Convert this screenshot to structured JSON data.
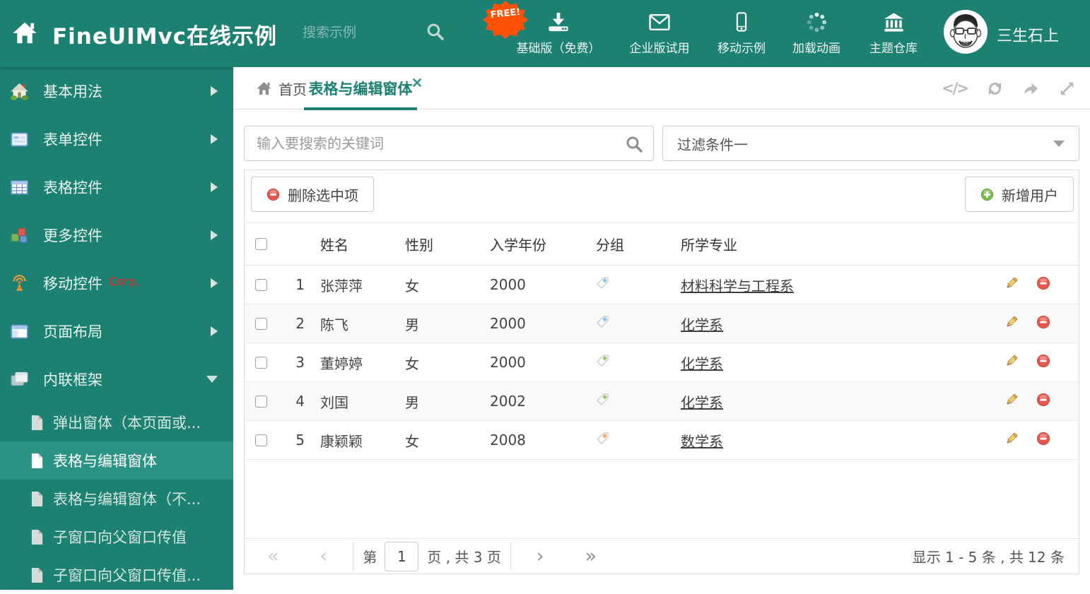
{
  "colors": {
    "accent_teal": "#1d8172",
    "sidebar_selected": "#2b9383",
    "free_badge": "#ff5107",
    "corp_badge": "#ff1a1a",
    "delete_red": "#e4574d",
    "add_green": "#7cbb4f",
    "tag_blue": "#85c6ee",
    "tag_green": "#94c566",
    "tag_orange": "#f4ab60"
  },
  "header": {
    "title": "FineUIMvc在线示例",
    "search_placeholder": "搜索示例",
    "free_badge": "FREE!",
    "nav": [
      {
        "label": "基础版（免费）"
      },
      {
        "label": "企业版试用"
      },
      {
        "label": "移动示例"
      },
      {
        "label": "加载动画"
      },
      {
        "label": "主题仓库"
      }
    ],
    "user_name": "三生石上"
  },
  "sidebar": {
    "items": [
      {
        "label": "基本用法"
      },
      {
        "label": "表单控件"
      },
      {
        "label": "表格控件"
      },
      {
        "label": "更多控件"
      },
      {
        "label": "移动控件",
        "badge": "Corp."
      },
      {
        "label": "页面布局"
      },
      {
        "label": "内联框架"
      }
    ],
    "subitems": [
      {
        "label": "弹出窗体（本页面或..."
      },
      {
        "label": "表格与编辑窗体"
      },
      {
        "label": "表格与编辑窗体（不..."
      },
      {
        "label": "子窗口向父窗口传值"
      },
      {
        "label": "子窗口向父窗口传值..."
      }
    ]
  },
  "tabs": [
    {
      "label": "首页"
    },
    {
      "label": "表格与编辑窗体"
    }
  ],
  "filters": {
    "search_placeholder": "输入要搜索的关键词",
    "filter_value": "过滤条件一"
  },
  "toolbar": {
    "delete_label": "删除选中项",
    "add_label": "新增用户"
  },
  "table": {
    "headers": [
      "姓名",
      "性别",
      "入学年份",
      "分组",
      "所学专业"
    ],
    "rows": [
      {
        "num": "1",
        "name": "张萍萍",
        "gender": "女",
        "year": "2000",
        "tag": "#85c6ee",
        "major": "材料科学与工程系"
      },
      {
        "num": "2",
        "name": "陈飞",
        "gender": "男",
        "year": "2000",
        "tag": "#85c6ee",
        "major": "化学系"
      },
      {
        "num": "3",
        "name": "董婷婷",
        "gender": "女",
        "year": "2000",
        "tag": "#94c566",
        "major": "化学系"
      },
      {
        "num": "4",
        "name": "刘国",
        "gender": "男",
        "year": "2002",
        "tag": "#94c566",
        "major": "化学系"
      },
      {
        "num": "5",
        "name": "康颖颖",
        "gender": "女",
        "year": "2008",
        "tag": "#f4ab60",
        "major": "数学系"
      }
    ]
  },
  "pagination": {
    "page_prefix": "第",
    "page_value": "1",
    "page_suffix": "页 , 共 3 页",
    "summary": "显示 1 - 5 条 , 共 12 条",
    "icons": {
      "first": "«",
      "prev": "‹",
      "next": "›",
      "last": "»"
    }
  },
  "icons": {
    "code": "</>"
  }
}
